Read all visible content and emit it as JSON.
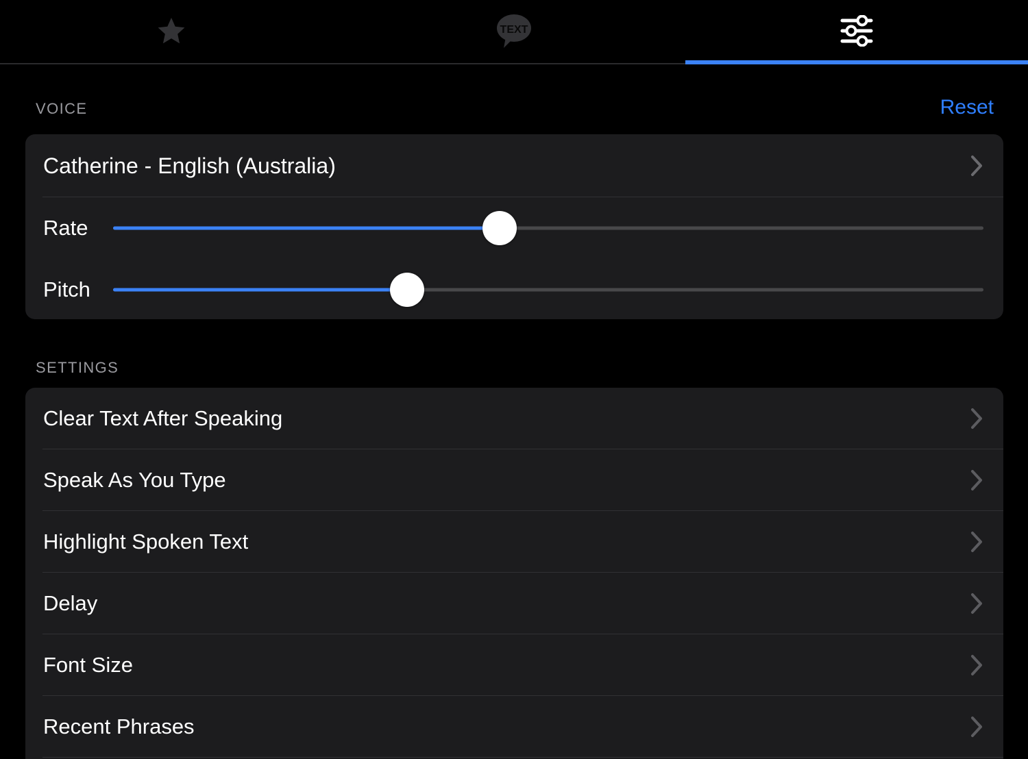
{
  "tabs": [
    {
      "id": "favorites",
      "icon": "star-icon",
      "label": "Favorites",
      "active": false
    },
    {
      "id": "text",
      "icon": "text-bubble-icon",
      "label": "TEXT",
      "active": false
    },
    {
      "id": "settings",
      "icon": "sliders-icon",
      "label": "Settings",
      "active": true
    }
  ],
  "colors": {
    "accent": "#3b82f6",
    "link": "#2f7fff",
    "card": "#1c1c1e",
    "background": "#000000",
    "track": "#48484a",
    "knob": "#ffffff",
    "divider": "#313134",
    "section_header": "#9a9a9f",
    "chevron": "#5c5c60",
    "inactive_icon": "#333336"
  },
  "voice_section": {
    "title": "VOICE",
    "reset_label": "Reset",
    "voice_row": {
      "label": "Catherine - English (Australia)",
      "chevron": "chevron-right-icon"
    },
    "sliders": [
      {
        "id": "rate",
        "label": "Rate",
        "percent": 44.4,
        "min": 0,
        "max": 100
      },
      {
        "id": "pitch",
        "label": "Pitch",
        "percent": 33.8,
        "min": 0,
        "max": 100
      }
    ]
  },
  "settings_section": {
    "title": "SETTINGS",
    "rows": [
      {
        "label": "Clear Text After Speaking",
        "chevron": "chevron-right-icon"
      },
      {
        "label": "Speak As You Type",
        "chevron": "chevron-right-icon"
      },
      {
        "label": "Highlight Spoken Text",
        "chevron": "chevron-right-icon"
      },
      {
        "label": "Delay",
        "chevron": "chevron-right-icon"
      },
      {
        "label": "Font Size",
        "chevron": "chevron-right-icon"
      },
      {
        "label": "Recent Phrases",
        "chevron": "chevron-right-icon"
      }
    ]
  }
}
